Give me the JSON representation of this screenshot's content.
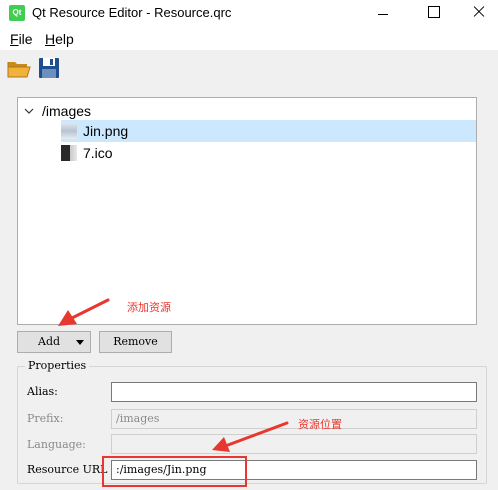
{
  "window": {
    "app_icon_text": "Qt",
    "title": "Qt Resource Editor - Resource.qrc"
  },
  "menu": {
    "file_mnemonic": "F",
    "file_rest": "ile",
    "help_mnemonic": "H",
    "help_rest": "elp"
  },
  "toolbar": {
    "open_icon": "folder-open-icon",
    "save_icon": "floppy-save-icon"
  },
  "tree": {
    "prefix": "/images",
    "files": [
      {
        "name": "Jin.png",
        "selected": true
      },
      {
        "name": "7.ico",
        "selected": false
      }
    ]
  },
  "buttons": {
    "add": "Add",
    "remove": "Remove"
  },
  "properties": {
    "group_title": "Properties",
    "alias_label": "Alias:",
    "alias_value": "",
    "prefix_label": "Prefix:",
    "prefix_value": "/images",
    "language_label": "Language:",
    "language_value": "",
    "url_label": "Resource URL",
    "url_value": ":/images/Jin.png"
  },
  "annotations": {
    "add_note": "添加资源",
    "url_note": "资源位置",
    "color": "#e8372e"
  },
  "colors": {
    "selection": "#cce8ff",
    "qt_green": "#41cd52"
  }
}
